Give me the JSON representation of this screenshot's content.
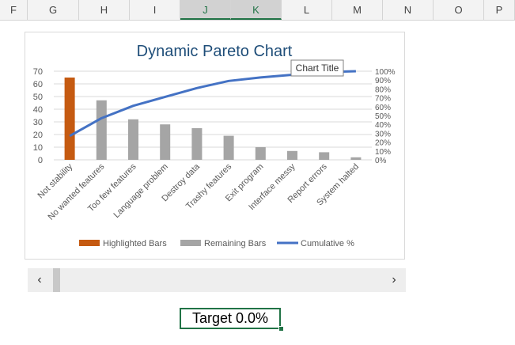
{
  "spreadsheet": {
    "columns": [
      {
        "label": "F",
        "selected": false
      },
      {
        "label": "G",
        "selected": false
      },
      {
        "label": "H",
        "selected": false
      },
      {
        "label": "I",
        "selected": false
      },
      {
        "label": "J",
        "selected": true
      },
      {
        "label": "K",
        "selected": true
      },
      {
        "label": "L",
        "selected": false
      },
      {
        "label": "M",
        "selected": false
      },
      {
        "label": "N",
        "selected": false
      },
      {
        "label": "O",
        "selected": false
      },
      {
        "label": "P",
        "selected": false
      }
    ],
    "target_cell_text": "Target 0.0%"
  },
  "scrollbar": {
    "left_icon": "chevron-left-icon",
    "right_icon": "chevron-right-icon",
    "left_glyph": "‹",
    "right_glyph": "›"
  },
  "chart_data": {
    "type": "bar",
    "title": "Dynamic Pareto Chart",
    "tooltip": "Chart Title",
    "categories": [
      "Not stability",
      "No wanted features",
      "Too few features",
      "Language problem",
      "Destroy data",
      "Trashy features",
      "Exit program",
      "Interface messy",
      "Report errors",
      "System halted"
    ],
    "series": [
      {
        "name": "Highlighted Bars",
        "kind": "bar",
        "values": [
          65,
          0,
          0,
          0,
          0,
          0,
          0,
          0,
          0,
          0
        ]
      },
      {
        "name": "Remaining Bars",
        "kind": "bar",
        "values": [
          0,
          47,
          32,
          28,
          25,
          19,
          10,
          7,
          6,
          2
        ]
      },
      {
        "name": "Cumulative %",
        "kind": "line",
        "axis": "secondary",
        "values": [
          27,
          47,
          61,
          71,
          81,
          89,
          93,
          96,
          99,
          100
        ]
      }
    ],
    "ylim": [
      0,
      70
    ],
    "yticks": [
      "0",
      "10",
      "20",
      "30",
      "40",
      "50",
      "60",
      "70"
    ],
    "y2lim": [
      0,
      100
    ],
    "y2ticks": [
      "0%",
      "10%",
      "20%",
      "30%",
      "40%",
      "50%",
      "60%",
      "70%",
      "80%",
      "90%",
      "100%"
    ],
    "grid": true,
    "legend_position": "bottom",
    "colors": {
      "highlighted": "#c55a11",
      "remaining": "#a5a5a5",
      "cumulative": "#4472c4",
      "title": "#1f4e79",
      "grid": "#d9d9d9",
      "tick_text": "#595959"
    }
  }
}
